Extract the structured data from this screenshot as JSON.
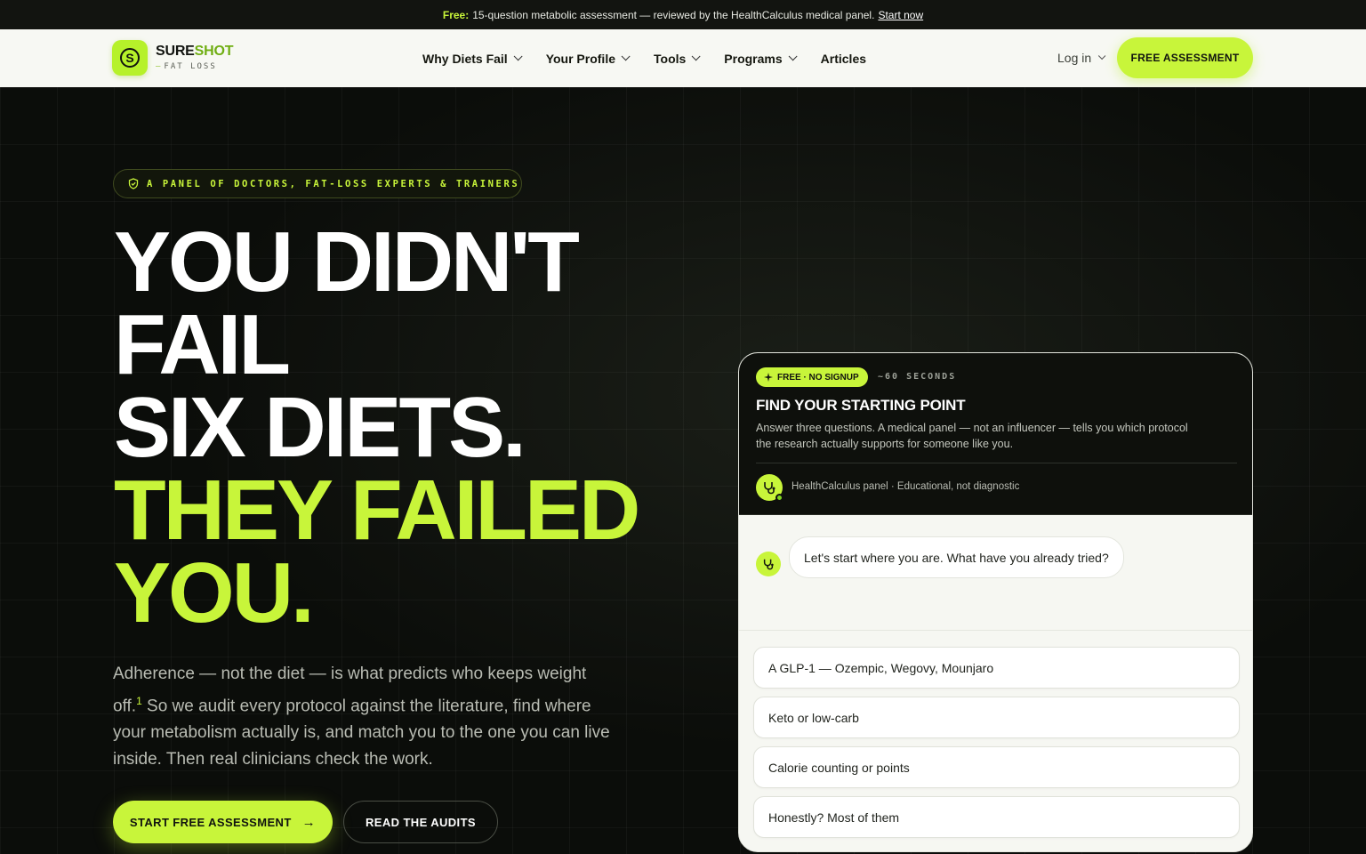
{
  "announcement": {
    "free_label": "Free:",
    "text": "15-question metabolic assessment — reviewed by the HealthCalculus medical panel.",
    "link": "Start now"
  },
  "logo": {
    "brand_a": "SURE",
    "brand_b": "SHOT",
    "dash": "—",
    "sub": "FAT LOSS",
    "mark_letter": "S"
  },
  "nav": {
    "items": [
      {
        "label": "Why Diets Fail",
        "has_dropdown": true
      },
      {
        "label": "Your Profile",
        "has_dropdown": true
      },
      {
        "label": "Tools",
        "has_dropdown": true
      },
      {
        "label": "Programs",
        "has_dropdown": true
      },
      {
        "label": "Articles",
        "has_dropdown": false
      }
    ],
    "login": "Log in",
    "cta": "FREE ASSESSMENT"
  },
  "hero": {
    "pill": "A PANEL OF DOCTORS, FAT-LOSS EXPERTS & TRAINERS",
    "headline": [
      "YOU DIDN'T",
      "FAIL",
      "SIX DIETS."
    ],
    "headline_accent": [
      "THEY FAILED",
      "YOU."
    ],
    "desc_part1": "Adherence — not the diet — is what predicts who keeps weight off.",
    "desc_sup": "1",
    "desc_part2": " So we audit every protocol against the literature, find where your metabolism actually is, and match you to the one you can live inside. Then real clinicians check the work.",
    "primary_button": "START FREE ASSESSMENT",
    "primary_arrow": "→",
    "secondary_button": "READ THE AUDITS"
  },
  "card": {
    "badge": "FREE · NO SIGNUP",
    "duration": "~60 SECONDS",
    "title": "FIND YOUR STARTING POINT",
    "desc": "Answer three questions. A medical panel — not an influencer — tells you which protocol the research actually supports for someone like you.",
    "panel_line": "HealthCalculus panel · Educational, not diagnostic",
    "question": "Let's start where you are. What have you already tried?",
    "options": [
      "A GLP-1 — Ozempic, Wegovy, Mounjaro",
      "Keto or low-carb",
      "Calorie counting or points",
      "Honestly? Most of them"
    ]
  },
  "colors": {
    "accent": "#c8f53a",
    "background": "#0b0d0a",
    "header_bg": "#f7f8f3"
  }
}
